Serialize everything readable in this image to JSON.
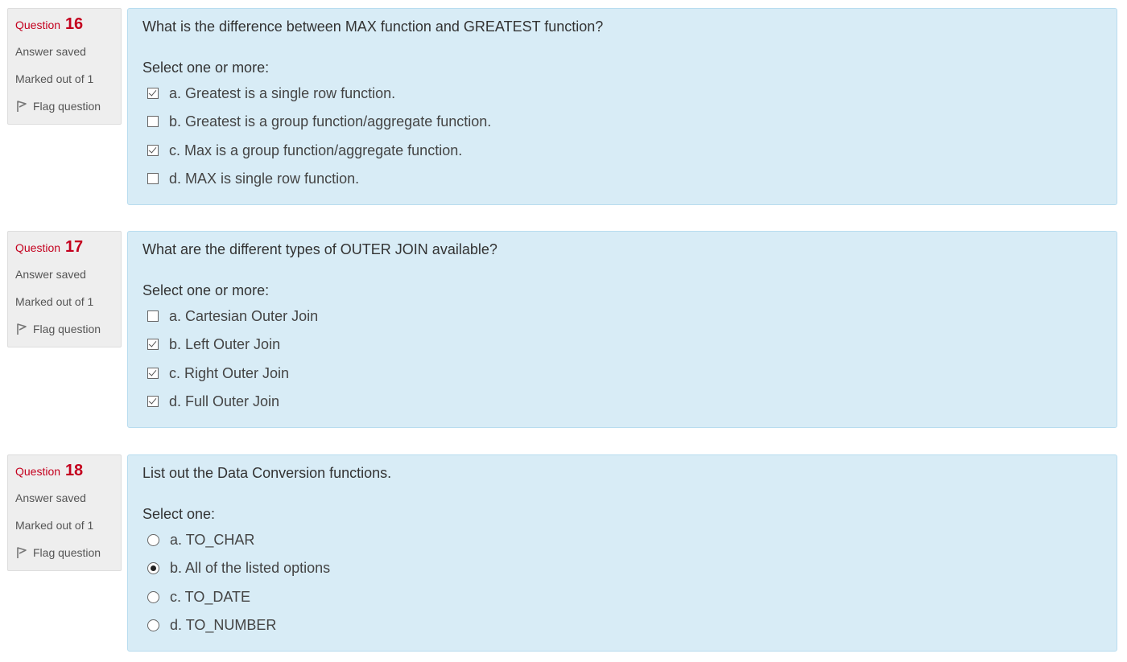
{
  "questions": [
    {
      "label": "Question",
      "number": "16",
      "state": "Answer saved",
      "grade": "Marked out of 1",
      "flag_label": "Flag question",
      "flag_icon": "flag-icon",
      "text": "What is the difference between MAX function and GREATEST function?",
      "prompt": "Select one or more:",
      "input_type": "checkbox",
      "options": [
        {
          "label": "a. Greatest is a single row function.",
          "checked": true
        },
        {
          "label": "b. Greatest is a group function/aggregate function.",
          "checked": false
        },
        {
          "label": "c. Max is a group function/aggregate function.",
          "checked": true
        },
        {
          "label": "d. MAX is single row function.",
          "checked": false
        }
      ]
    },
    {
      "label": "Question",
      "number": "17",
      "state": "Answer saved",
      "grade": "Marked out of 1",
      "flag_label": "Flag question",
      "flag_icon": "flag-icon",
      "text": "What are the different types of OUTER JOIN available?",
      "prompt": "Select one or more:",
      "input_type": "checkbox",
      "options": [
        {
          "label": "a. Cartesian Outer Join",
          "checked": false
        },
        {
          "label": "b. Left Outer Join",
          "checked": true
        },
        {
          "label": "c. Right Outer Join",
          "checked": true
        },
        {
          "label": "d. Full Outer Join",
          "checked": true
        }
      ]
    },
    {
      "label": "Question",
      "number": "18",
      "state": "Answer saved",
      "grade": "Marked out of 1",
      "flag_label": "Flag question",
      "flag_icon": "flag-icon",
      "text": "List out the Data Conversion functions.",
      "prompt": "Select one:",
      "input_type": "radio",
      "options": [
        {
          "label": "a. TO_CHAR",
          "checked": false
        },
        {
          "label": "b. All of the listed options",
          "checked": true
        },
        {
          "label": "c. TO_DATE",
          "checked": false
        },
        {
          "label": "d. TO_NUMBER",
          "checked": false
        }
      ]
    }
  ],
  "colors": {
    "question_label": "#c4001e",
    "info_bg": "#eeeeee",
    "content_bg": "#d8ecf6",
    "content_border": "#b8dcef"
  }
}
